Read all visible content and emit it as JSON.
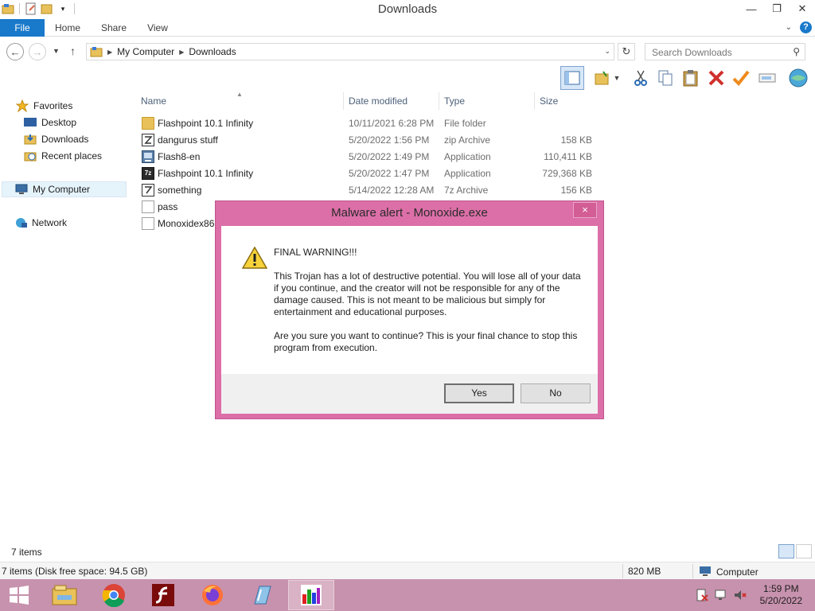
{
  "window": {
    "title": "Downloads"
  },
  "ribbon": {
    "tabs": [
      "File",
      "Home",
      "Share",
      "View"
    ]
  },
  "address": {
    "path": [
      "My Computer",
      "Downloads"
    ],
    "search_placeholder": "Search Downloads"
  },
  "nav": {
    "favorites": "Favorites",
    "desktop": "Desktop",
    "downloads": "Downloads",
    "recent": "Recent places",
    "computer": "My Computer",
    "network": "Network"
  },
  "columns": {
    "name": "Name",
    "date": "Date modified",
    "type": "Type",
    "size": "Size"
  },
  "files": [
    {
      "name": "Flashpoint 10.1 Infinity",
      "date": "10/11/2021 6:28 PM",
      "type": "File folder",
      "size": "",
      "icon": "folder-icon"
    },
    {
      "name": "dangurus stuff",
      "date": "5/20/2022 1:56 PM",
      "type": "zip Archive",
      "size": "158 KB",
      "icon": "archive-icon"
    },
    {
      "name": "Flash8-en",
      "date": "5/20/2022 1:49 PM",
      "type": "Application",
      "size": "110,411 KB",
      "icon": "installer-icon"
    },
    {
      "name": "Flashpoint 10.1 Infinity",
      "date": "5/20/2022 1:47 PM",
      "type": "Application",
      "size": "729,368 KB",
      "icon": "7zip-icon"
    },
    {
      "name": "something",
      "date": "5/14/2022 12:28 AM",
      "type": "7z Archive",
      "size": "156 KB",
      "icon": "archive-icon"
    },
    {
      "name": "pass",
      "date": "",
      "type": "",
      "size": "",
      "icon": "document-icon"
    },
    {
      "name": "Monoxidex86.",
      "date": "",
      "type": "",
      "size": "",
      "icon": "document-icon"
    }
  ],
  "status": {
    "items": "7 items",
    "disk": "7 items (Disk free space: 94.5 GB)",
    "size": "820 MB",
    "location": "Computer"
  },
  "dialog": {
    "title": "Malware alert - Monoxide.exe",
    "close": "×",
    "heading": "FINAL WARNING!!!",
    "body1": "This Trojan has a lot of destructive potential. You will lose all of your data if you continue, and the creator will not be responsible for any of the damage caused. This is not meant to be malicious but simply for entertainment and educational purposes.",
    "body2": "Are you sure you want to continue? This is your final chance to stop this program from execution.",
    "yes": "Yes",
    "no": "No"
  },
  "taskbar": {
    "apps": [
      "file-explorer-icon",
      "chrome-icon",
      "flash-icon",
      "firefox-icon",
      "notepad-icon",
      "monoxide-icon"
    ],
    "time": "1:59 PM",
    "date": "5/20/2022"
  },
  "colors": {
    "accent": "#1979ca",
    "dialog_border": "#dc6fa8",
    "taskbar": "#c792ad"
  }
}
